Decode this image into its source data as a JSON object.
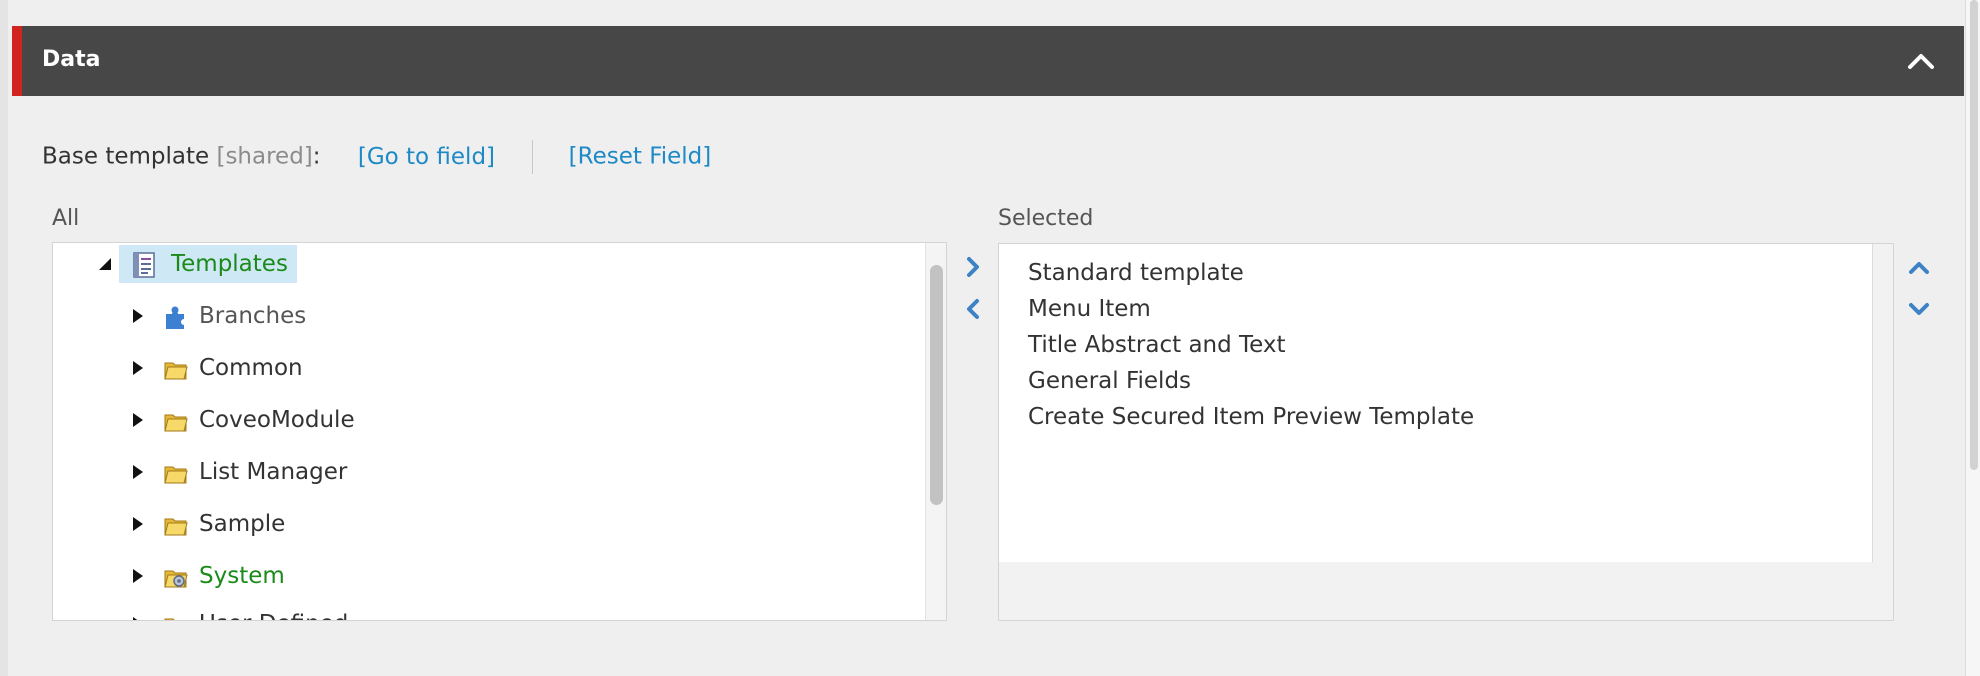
{
  "section": {
    "title": "Data"
  },
  "field": {
    "label": "Base template",
    "shared": "[shared]",
    "colon": ":",
    "goto_link": "[Go to field]",
    "reset_link": "[Reset Field]"
  },
  "all_panel": {
    "label": "All",
    "root": {
      "label": "Templates",
      "icon": "template-icon",
      "expanded": true
    },
    "children": [
      {
        "label": "Branches",
        "icon": "puzzle-icon"
      },
      {
        "label": "Common",
        "icon": "folder-icon"
      },
      {
        "label": "CoveoModule",
        "icon": "folder-icon"
      },
      {
        "label": "List Manager",
        "icon": "folder-icon"
      },
      {
        "label": "Sample",
        "icon": "folder-icon"
      },
      {
        "label": "System",
        "icon": "system-folder-icon"
      },
      {
        "label": "User Defined",
        "icon": "folder-icon"
      }
    ]
  },
  "selected_panel": {
    "label": "Selected",
    "items": [
      "Standard template",
      "Menu Item",
      "Title Abstract and Text",
      "General Fields",
      "Create Secured Item Preview Template"
    ]
  },
  "colors": {
    "header_bg": "#474747",
    "accent": "#d2241f",
    "link": "#1d8ac7",
    "tree_green": "#1a8a1a",
    "arrow_blue": "#3d82c4"
  }
}
